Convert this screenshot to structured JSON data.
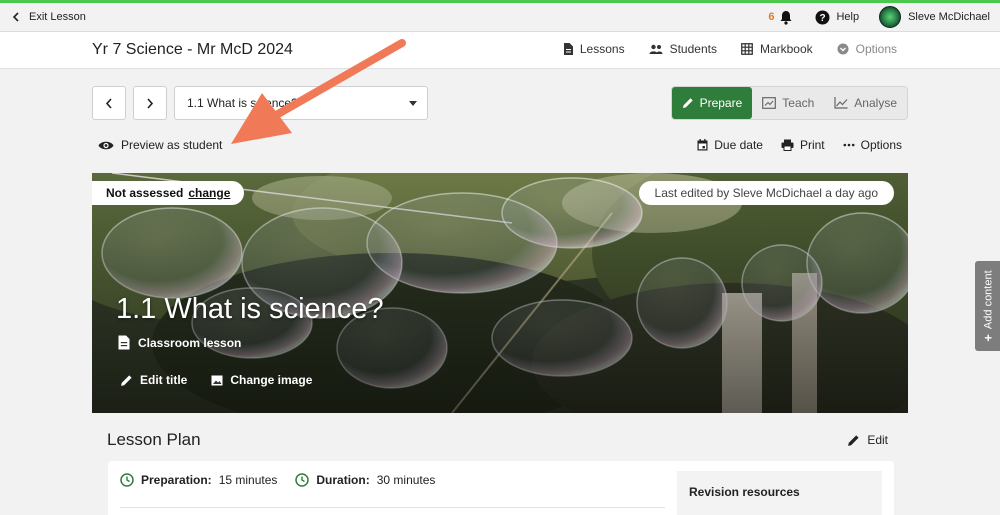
{
  "topbar": {
    "exit_label": "Exit Lesson",
    "notification_count": "6",
    "help_label": "Help",
    "user_name": "Sleve McDichael"
  },
  "header": {
    "course_title": "Yr 7 Science - Mr McD 2024",
    "nav": {
      "lessons": "Lessons",
      "students": "Students",
      "markbook": "Markbook",
      "options": "Options"
    }
  },
  "controls": {
    "lesson_select_value": "1.1 What is science?",
    "modes": {
      "prepare": "Prepare",
      "teach": "Teach",
      "analyse": "Analyse"
    },
    "active_mode": "Prepare"
  },
  "actions": {
    "preview_label": "Preview as student",
    "due_date": "Due date",
    "print": "Print",
    "options": "Options"
  },
  "hero": {
    "assessment_status": "Not assessed",
    "change_link": "change",
    "last_edited": "Last edited by Sleve McDichael a day ago",
    "title": "1.1 What is science?",
    "type": "Classroom lesson",
    "edit_title": "Edit title",
    "change_image": "Change image"
  },
  "plan": {
    "title": "Lesson Plan",
    "edit": "Edit",
    "preparation_label": "Preparation:",
    "preparation_value": "15 minutes",
    "duration_label": "Duration:",
    "duration_value": "30 minutes",
    "revision_resources": "Revision resources"
  },
  "side_tab": {
    "label": "Add content"
  },
  "colors": {
    "accent_green": "#2f7d3a",
    "top_green": "#4cc94c",
    "notification_orange": "#e07b27",
    "annotation_arrow": "#f07a58"
  }
}
